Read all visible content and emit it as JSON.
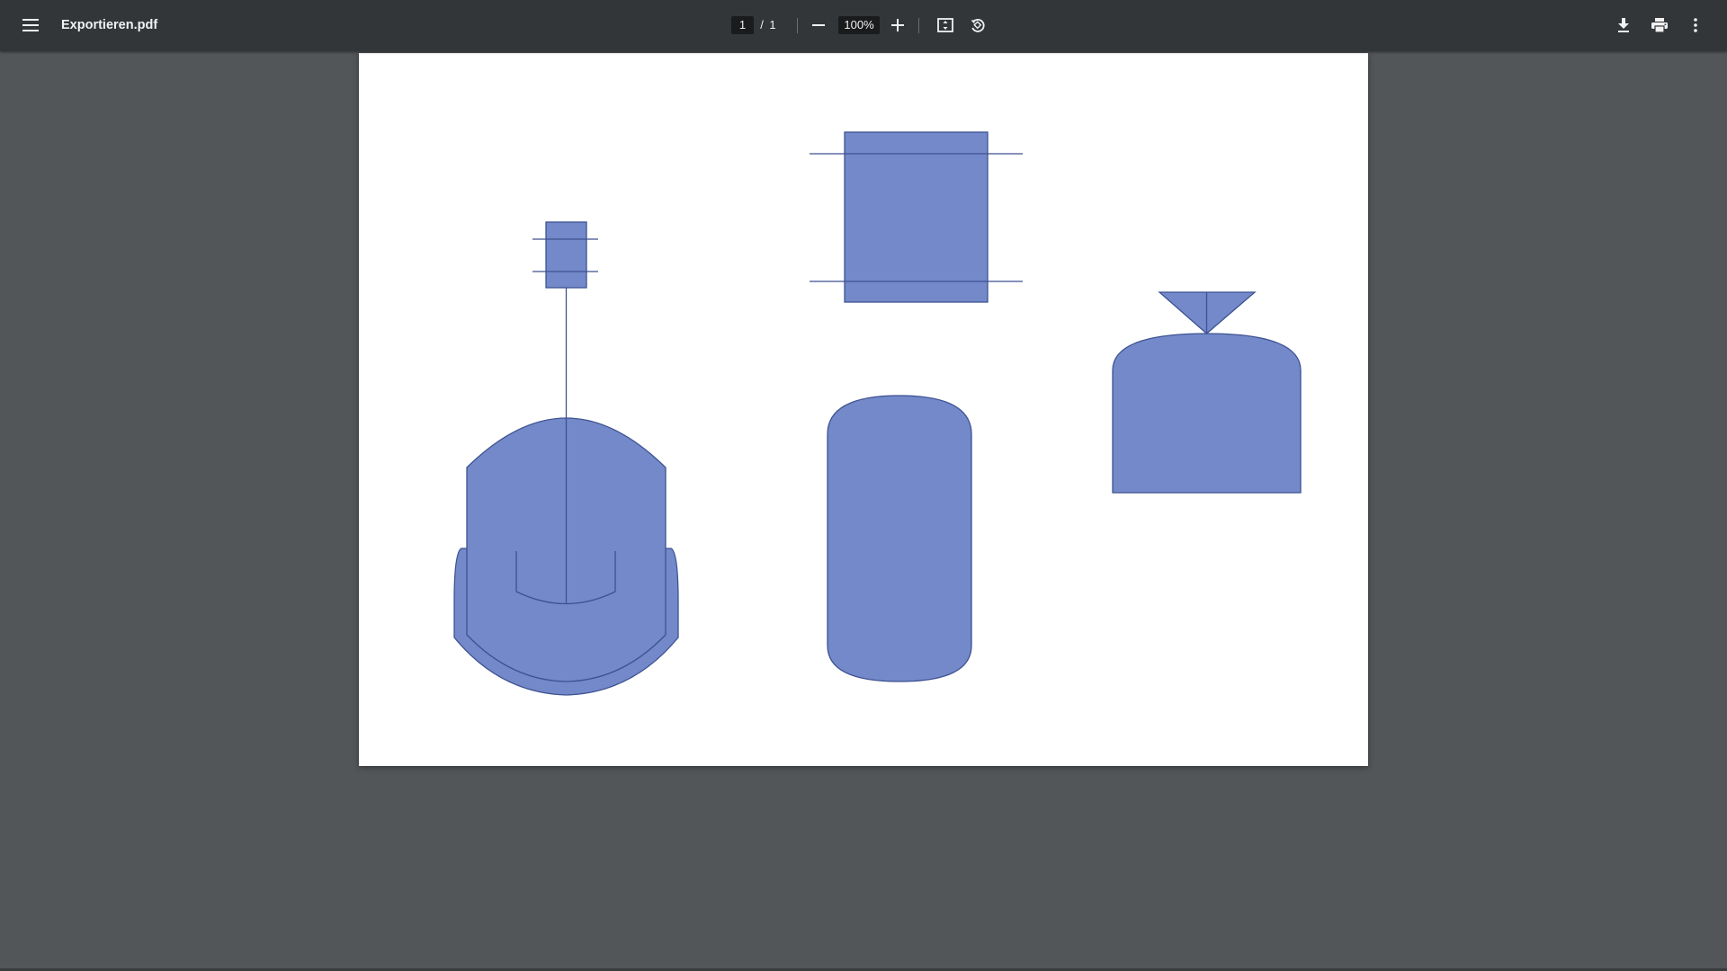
{
  "toolbar": {
    "menu_icon": "hamburger-menu-icon",
    "filename": "Exportieren.pdf",
    "current_page": "1",
    "page_separator": "/",
    "total_pages": "1",
    "zoom_out_icon": "minus-icon",
    "zoom_level": "100%",
    "zoom_in_icon": "plus-icon",
    "fit_page_icon": "fit-to-page-icon",
    "rotate_icon": "rotate-counterclockwise-icon",
    "download_icon": "download-icon",
    "print_icon": "print-icon",
    "more_icon": "more-vertical-icon"
  },
  "document": {
    "page_background": "#ffffff",
    "shape_fill": "#7389c9",
    "shape_stroke": "#3e5291",
    "shapes": [
      "stirred-reactor-with-agitator-and-motor",
      "heat-exchanger-block",
      "vertical-vessel",
      "tank-with-funnel-inlet"
    ]
  },
  "colors": {
    "toolbar_background": "#323639",
    "viewer_background": "#525659",
    "toolbar_text": "#f1f1f1",
    "input_background": "#191b1c"
  }
}
